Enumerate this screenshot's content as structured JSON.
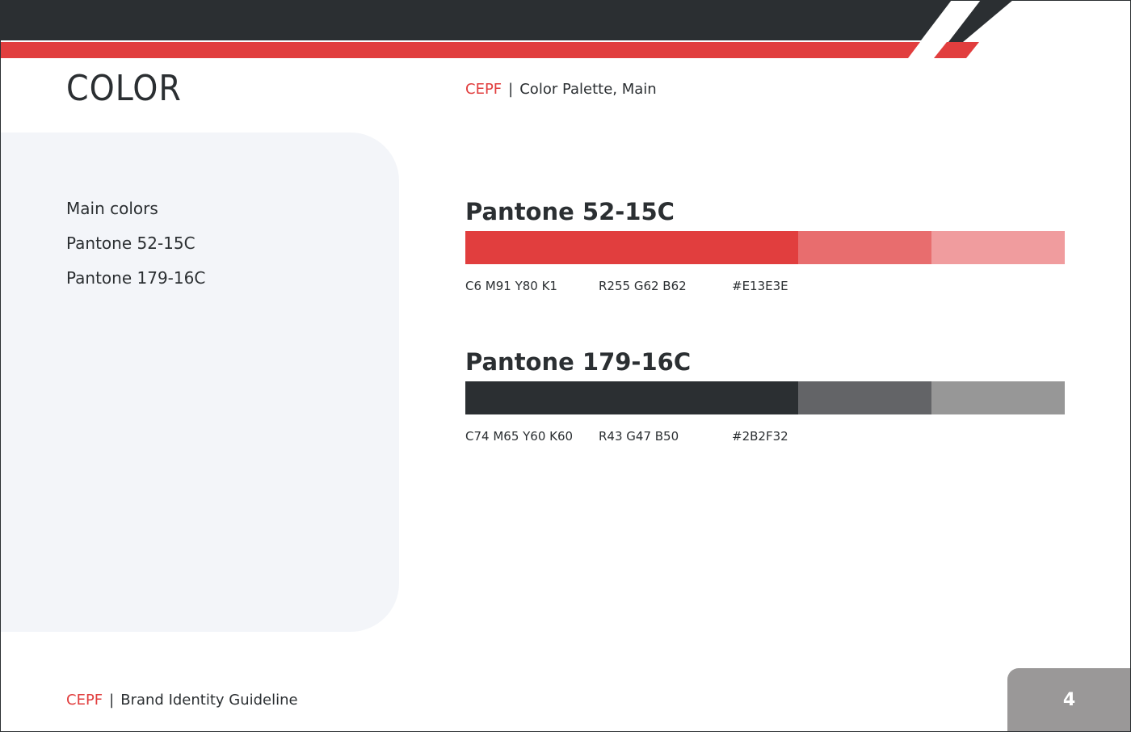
{
  "header": {
    "title": "COLOR",
    "brand": "CEPF",
    "separator": "|",
    "section": "Color Palette, Main"
  },
  "sidebar": {
    "items": [
      {
        "label": "Main colors"
      },
      {
        "label": "Pantone 52-15C"
      },
      {
        "label": "Pantone 179-16C"
      }
    ]
  },
  "swatches": [
    {
      "name": "Pantone 52-15C",
      "cmyk": "C6  M91  Y80  K1",
      "rgb": "R255 G62 B62",
      "hex": "#E13E3E",
      "tints": [
        "#e13e3e",
        "#e86d6e",
        "#f09c9e"
      ]
    },
    {
      "name": "Pantone 179-16C",
      "cmyk": "C74  M65  Y60  K60",
      "rgb": "R43 G47 B50",
      "hex": "#2B2F32",
      "tints": [
        "#2b2f32",
        "#636467",
        "#979797"
      ]
    }
  ],
  "footer": {
    "brand": "CEPF",
    "separator": "|",
    "label": "Brand Identity Guideline",
    "page_number": "4"
  },
  "colors": {
    "brand_red": "#E13E3E",
    "brand_dark": "#2B2F32",
    "panel_bg": "#F3F5F9",
    "page_tab": "#9A9898"
  }
}
